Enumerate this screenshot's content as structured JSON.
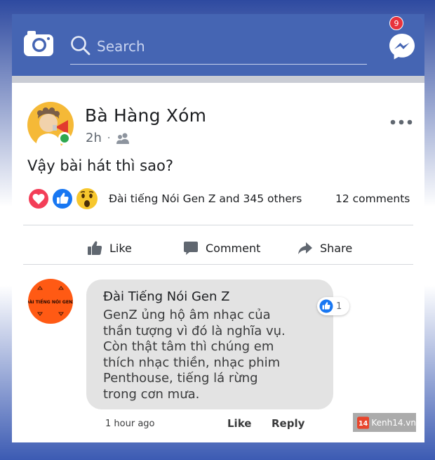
{
  "header": {
    "search_placeholder": "Search",
    "messenger_badge": "9",
    "icons": [
      "camera-icon",
      "search-icon",
      "messenger-icon"
    ]
  },
  "post": {
    "author": "Bà Hàng Xóm",
    "time": "2h",
    "separator": "·",
    "audience_icon": "friends-icon",
    "text": "Vậy bài hát thì sao?",
    "reactions": [
      "love",
      "like",
      "wow"
    ],
    "reaction_summary": "Đài tiếng Nói Gen Z and 345 others",
    "comment_count": "12 comments"
  },
  "actions": {
    "like": "Like",
    "comment": "Comment",
    "share": "Share"
  },
  "comment": {
    "avatar_text": "ĐÀI TIẾNG NÓI GENZ",
    "author": "Đài Tiếng Nói Gen Z",
    "text": "GenZ ủng hộ âm nhạc của\nthần tượng vì đó là nghĩa vụ.\nCòn thật tâm thì chúng em\nthích nhạc thiền, nhạc phim\nPenthouse,  tiếng lá rừng\ntrong cơn mưa.",
    "like_count": "1",
    "time": "1 hour ago",
    "like_label": "Like",
    "reply_label": "Reply"
  },
  "watermark": {
    "badge": "14",
    "text": "Kenh14.vn"
  },
  "colors": {
    "header_blue": "#4565b3",
    "like_blue": "#1877f2",
    "love_red": "#f33e58",
    "wow_yellow": "#f7c72d",
    "online_green": "#2fa84f",
    "comment_avatar_orange": "#ff5a14"
  }
}
